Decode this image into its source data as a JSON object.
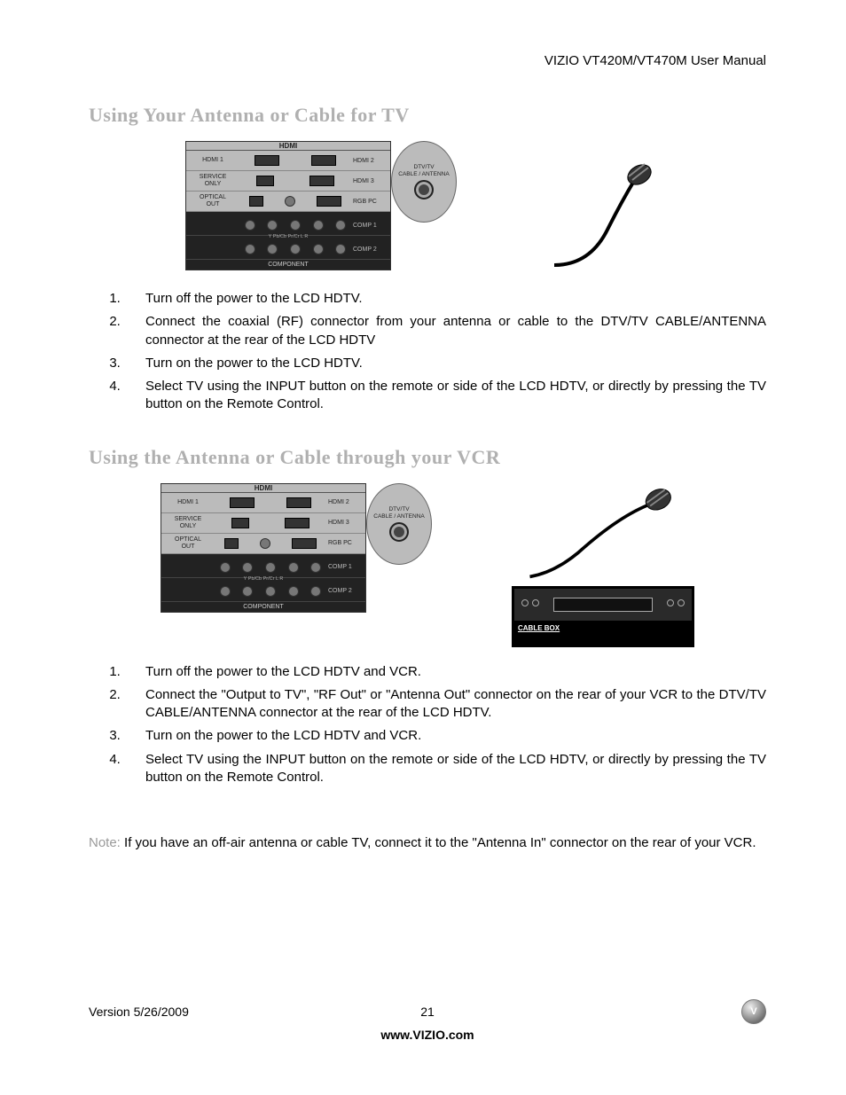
{
  "header": {
    "title": "VIZIO VT420M/VT470M User Manual"
  },
  "section1": {
    "heading": "Using Your Antenna or Cable for TV",
    "panel": {
      "top": "HDMI",
      "rows": [
        {
          "left": "HDMI 1",
          "right": "HDMI 2"
        },
        {
          "left": "SERVICE\nONLY",
          "right": "HDMI 3"
        },
        {
          "left": "OPTICAL\nOUT",
          "right": "RGB PC"
        }
      ],
      "bottom": {
        "rows": [
          {
            "right": "COMP 1",
            "sub": "Y   Pb/Cb   Pr/Cr        L       R"
          },
          {
            "right": "COMP 2"
          }
        ],
        "label": "COMPONENT"
      },
      "ant": {
        "line1": "DTV/TV",
        "line2": "CABLE / ANTENNA"
      }
    },
    "steps": [
      "Turn off the power to the LCD HDTV.",
      "Connect the coaxial (RF) connector from your antenna or cable to the DTV/TV CABLE/ANTENNA connector at the rear of the LCD HDTV",
      "Turn on the power to the LCD HDTV.",
      "Select TV using the INPUT button on the remote or side of the LCD HDTV, or directly by pressing the TV button on the Remote Control."
    ]
  },
  "section2": {
    "heading": "Using the Antenna or Cable through your VCR",
    "cableboxLabel": "CABLE BOX",
    "steps": [
      "Turn off the power to the LCD HDTV and VCR.",
      "Connect the \"Output to TV\", \"RF Out\" or \"Antenna Out\" connector on the rear of your VCR to the DTV/TV CABLE/ANTENNA connector at the rear of the LCD HDTV.",
      "Turn on the power to the LCD HDTV and VCR.",
      "Select TV using the INPUT button on the remote or side of the LCD HDTV, or directly by pressing the TV button on the Remote Control."
    ]
  },
  "note": {
    "label": "Note:",
    "text": " If you have an off-air antenna or cable TV, connect it to the \"Antenna In\" connector on the rear of your VCR."
  },
  "footer": {
    "version": "Version 5/26/2009",
    "pageNumber": "21",
    "url": "www.VIZIO.com",
    "logo": "V"
  }
}
